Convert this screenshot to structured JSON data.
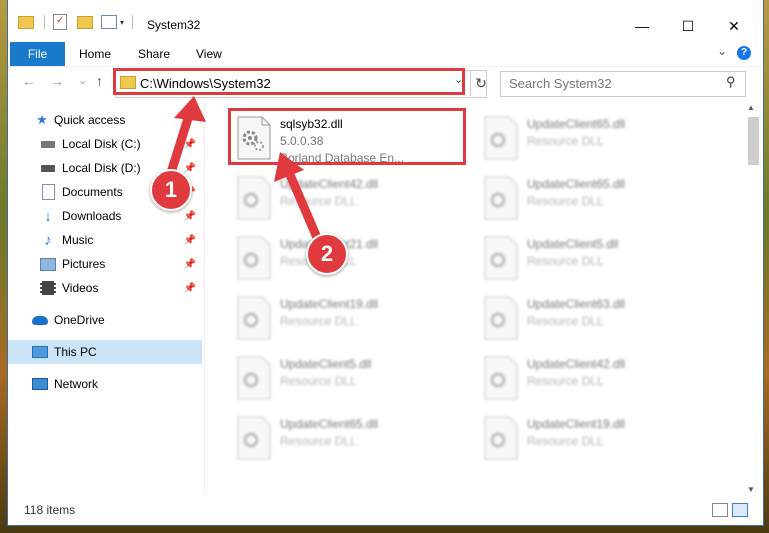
{
  "window": {
    "title": "System32",
    "minimize": "—",
    "maximize": "☐",
    "close": "✕"
  },
  "ribbon": {
    "file": "File",
    "home": "Home",
    "share": "Share",
    "view": "View",
    "help": "?"
  },
  "nav": {
    "back": "←",
    "forward": "→",
    "recent": "⌄",
    "up": "↑",
    "address": "C:\\Windows\\System32",
    "refresh": "↻",
    "search_placeholder": "Search System32"
  },
  "sidebar": {
    "items": [
      {
        "label": "Quick access",
        "icon": "star-icon"
      },
      {
        "label": "Local Disk (C:)",
        "icon": "drive-icon",
        "pinned": true
      },
      {
        "label": "Local Disk (D:)",
        "icon": "drive-icon",
        "pinned": true
      },
      {
        "label": "Documents",
        "icon": "documents-icon",
        "pinned": true
      },
      {
        "label": "Downloads",
        "icon": "download-icon",
        "pinned": true
      },
      {
        "label": "Music",
        "icon": "music-icon",
        "pinned": true
      },
      {
        "label": "Pictures",
        "icon": "pictures-icon",
        "pinned": true
      },
      {
        "label": "Videos",
        "icon": "videos-icon",
        "pinned": true
      },
      {
        "label": "OneDrive",
        "icon": "cloud-icon"
      },
      {
        "label": "This PC",
        "icon": "computer-icon",
        "selected": true
      },
      {
        "label": "Network",
        "icon": "network-icon"
      }
    ]
  },
  "files": {
    "featured": {
      "name": "sqlsyb32.dll",
      "version": "5.0.0.38",
      "description": "Borland Database En..."
    },
    "left": [
      {
        "name": "UpdateClient42.dll",
        "type": "Resource DLL"
      },
      {
        "name": "UpdateClient21.dll",
        "type": "Resource DLL"
      },
      {
        "name": "UpdateClient19.dll",
        "type": "Resource DLL"
      },
      {
        "name": "UpdateClient5.dll",
        "type": "Resource DLL"
      },
      {
        "name": "UpdateClient65.dll",
        "type": "Resource DLL"
      }
    ],
    "right": [
      {
        "name": "UpdateClient65.dll",
        "type": "Resource DLL"
      },
      {
        "name": "UpdateClient65.dll",
        "type": "Resource DLL"
      },
      {
        "name": "UpdateClient5.dll",
        "type": "Resource DLL"
      },
      {
        "name": "UpdateClient63.dll",
        "type": "Resource DLL"
      },
      {
        "name": "UpdateClient42.dll",
        "type": "Resource DLL"
      },
      {
        "name": "UpdateClient19.dll",
        "type": "Resource DLL"
      }
    ]
  },
  "status": {
    "count": "118 items"
  },
  "callouts": {
    "one": "1",
    "two": "2",
    "color": "#e03a3e"
  }
}
